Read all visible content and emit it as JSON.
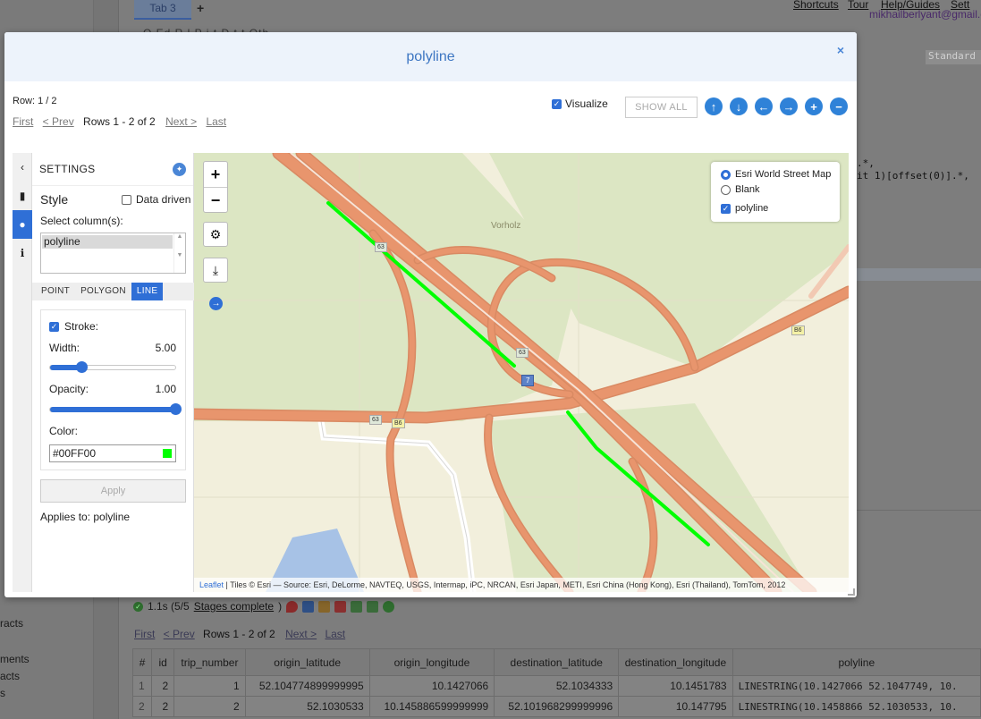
{
  "background": {
    "tab_label": "Tab 3",
    "add_tab": "+",
    "top_links": [
      "Shortcuts",
      "Tour",
      "Help/Guides",
      "Sett"
    ],
    "user_email": "mikhailberlyant@gmail.c",
    "subtabs": "Q  Ed  R  l  P  j  t  D  t  t  Oth",
    "standard_label": "Standard",
    "code_lines": [
      ".*,",
      "it 1)[offset(0)].*,"
    ],
    "left_texts": [
      "racts",
      "ments",
      "acts",
      "s"
    ],
    "status": {
      "time": "1.1s (5/5",
      "stages": "Stages complete",
      "close_paren": ")"
    },
    "pager": {
      "first": "First",
      "prev": "< Prev",
      "rows": "Rows 1 - 2 of 2",
      "next": "Next >",
      "last": "Last"
    },
    "table": {
      "columns": [
        "#",
        "id",
        "trip_number",
        "origin_latitude",
        "origin_longitude",
        "destination_latitude",
        "destination_longitude",
        "polyline"
      ],
      "rows": [
        [
          "1",
          "2",
          "1",
          "52.104774899999995",
          "10.1427066",
          "52.1034333",
          "10.1451783",
          "LINESTRING(10.1427066 52.1047749, 10."
        ],
        [
          "2",
          "2",
          "2",
          "52.1030533",
          "10.145886599999999",
          "52.101968299999996",
          "10.147795",
          "LINESTRING(10.1458866 52.1030533, 10."
        ]
      ]
    }
  },
  "modal": {
    "title": "polyline",
    "close": "×",
    "row_info": "Row: 1 / 2",
    "pager": {
      "first": "First",
      "prev": "< Prev",
      "rows": "Rows 1 - 2 of 2",
      "next": "Next >",
      "last": "Last"
    },
    "visualize_label": "Visualize",
    "visualize_checked": true,
    "show_all_label": "SHOW ALL",
    "nav_icons": [
      "arrow-up-icon",
      "arrow-down-icon",
      "arrow-left-icon",
      "arrow-right-icon",
      "plus-icon",
      "minus-icon"
    ]
  },
  "settings": {
    "header": "SETTINGS",
    "style_label": "Style",
    "data_driven_label": "Data driven",
    "data_driven_checked": false,
    "select_columns_label": "Select column(s):",
    "column_options": [
      "polyline"
    ],
    "geometry_tabs": [
      "POINT",
      "POLYGON",
      "LINE"
    ],
    "active_tab": "LINE",
    "stroke_label": "Stroke:",
    "stroke_checked": true,
    "width_label": "Width:",
    "width_value": "5.00",
    "width_fraction": 0.25,
    "opacity_label": "Opacity:",
    "opacity_value": "1.00",
    "opacity_fraction": 1.0,
    "color_label": "Color:",
    "color_value": "#00FF00",
    "apply_label": "Apply",
    "applies_to": "Applies to: polyline"
  },
  "map": {
    "layers": [
      {
        "label": "Esri World Street Map",
        "type": "radio",
        "checked": true
      },
      {
        "label": "Blank",
        "type": "radio",
        "checked": false
      },
      {
        "label": "polyline",
        "type": "checkbox",
        "checked": true
      }
    ],
    "place_label": "Vorholz",
    "road_shields": [
      "63",
      "63",
      "63",
      "B6",
      "7",
      "B6"
    ],
    "attribution_link": "Leaflet",
    "attribution_text": " | Tiles © Esri — Source: Esri, DeLorme, NAVTEQ, USGS, Intermap, iPC, NRCAN, Esri Japan, METI, Esri China (Hong Kong), Esri (Thailand), TomTom, 2012",
    "polyline_color": "#00FF00",
    "road_color": "#e8956d",
    "land_color": "#dce6c3",
    "water_color": "#a7c2e6"
  }
}
